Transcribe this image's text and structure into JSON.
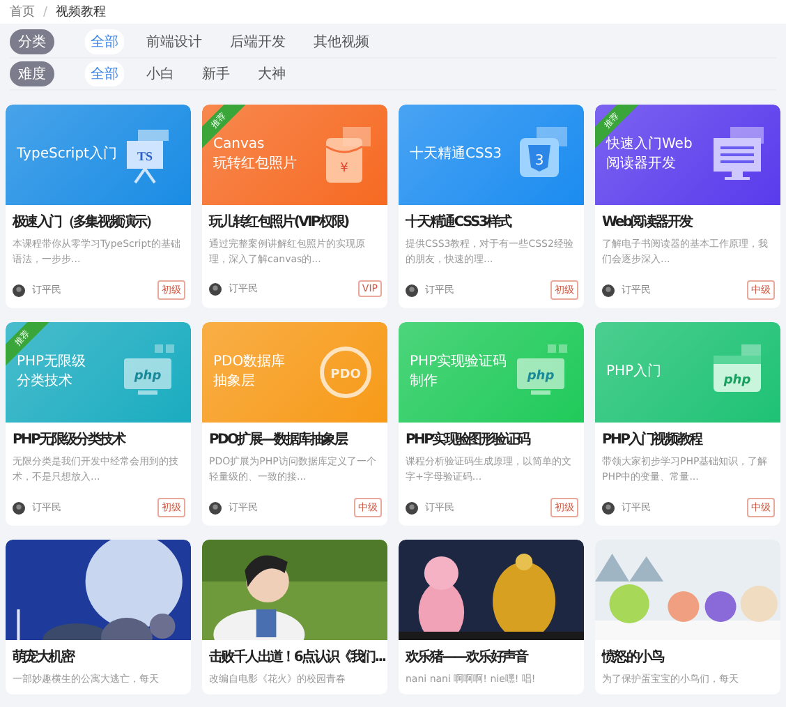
{
  "breadcrumb": [
    "首页",
    "视频教程"
  ],
  "separator": "/",
  "filters": [
    {
      "label": "分类",
      "options": [
        {
          "text": "全部",
          "selected": true
        },
        {
          "text": "前端设计",
          "selected": false
        },
        {
          "text": "后端开发",
          "selected": false
        },
        {
          "text": "其他视频",
          "selected": false
        }
      ]
    },
    {
      "label": "难度",
      "options": [
        {
          "text": "全部",
          "selected": true
        },
        {
          "text": "小白",
          "selected": false
        },
        {
          "text": "新手",
          "selected": false
        },
        {
          "text": "大神",
          "selected": false
        }
      ]
    }
  ],
  "cards": [
    {
      "media": {
        "kind": "banner",
        "color": "#1a8ce4",
        "art": {
          "kind": "board",
          "text": "TS"
        },
        "lines": [
          "TypeScript入门"
        ]
      },
      "recommended": false,
      "title": "极速入门（多集视频演示）",
      "description": "本课程带你从零学习TypeScript的基础语法，一步步...",
      "author": "订平民",
      "level": "初级"
    },
    {
      "media": {
        "kind": "banner",
        "color": "#f66a22",
        "art": {
          "kind": "envelope",
          "text": "¥"
        },
        "lines": [
          "Canvas",
          "玩转红包照片"
        ]
      },
      "recommended": true,
      "ribbon": "推荐",
      "title": "玩儿转红包照片(VIP权限)",
      "description": "通过完整案例讲解红包照片的实现原理，深入了解canvas的...",
      "author": "订平民",
      "level": "VIP"
    },
    {
      "media": {
        "kind": "banner",
        "color": "#1b8cf0",
        "art": {
          "kind": "shield",
          "text": "3"
        },
        "lines": [
          "十天精通CSS3"
        ]
      },
      "recommended": false,
      "title": "十天精通CSS3样式",
      "description": "提供CSS3教程，对于有一些CSS2经验的朋友，快速的理...",
      "author": "订平民",
      "level": "初级"
    },
    {
      "media": {
        "kind": "banner",
        "color": "#5a3bec",
        "art": {
          "kind": "monitor"
        },
        "lines": [
          "快速入门Web",
          "阅读器开发"
        ]
      },
      "recommended": true,
      "ribbon": "推荐",
      "title": "Web阅读器开发",
      "description": "了解电子书阅读器的基本工作原理，我们会逐步深入...",
      "author": "订平民",
      "level": "中级"
    },
    {
      "media": {
        "kind": "banner",
        "color": "#1aacc0",
        "art": {
          "kind": "php",
          "text": "php"
        },
        "lines": [
          "PHP无限级",
          "分类技术"
        ]
      },
      "recommended": true,
      "ribbon": "推荐",
      "title": "PHP无限级分类技术",
      "description": "无限分类是我们开发中经常会用到的技术，不是只想放入...",
      "author": "订平民",
      "level": "初级"
    },
    {
      "media": {
        "kind": "banner",
        "color": "#f79a18",
        "art": {
          "kind": "pdo",
          "text": "PDO"
        },
        "lines": [
          "PDO数据库",
          "抽象层"
        ]
      },
      "recommended": false,
      "title": "PDO扩展—数据库抽象层",
      "description": "PDO扩展为PHP访问数据库定义了一个轻量级的、一致的接...",
      "author": "订平民",
      "level": "中级"
    },
    {
      "media": {
        "kind": "banner",
        "color": "#20ca5a",
        "art": {
          "kind": "php",
          "text": "php"
        },
        "lines": [
          "PHP实现验证码",
          "制作"
        ]
      },
      "recommended": false,
      "title": "PHP实现验图形验证码",
      "description": "课程分析验证码生成原理，以简单的文字+字母验证码...",
      "author": "订平民",
      "level": "初级"
    },
    {
      "media": {
        "kind": "banner",
        "color": "#1ec274",
        "art": {
          "kind": "window",
          "text": "php"
        },
        "lines": [
          "PHP入门"
        ]
      },
      "recommended": false,
      "title": "PHP入门视频教程",
      "description": "带领大家初步学习PHP基础知识，了解PHP中的变量、常量...",
      "author": "订平民",
      "level": "中级"
    },
    {
      "recommended": false,
      "title": "萌宠大机密",
      "description": "一部妙趣横生的公寓大逃亡，每天"
    },
    {
      "recommended": false,
      "title": "击败千人出道！6点认识《我们...",
      "description": "改编自电影《花火》的校园青春"
    },
    {
      "recommended": false,
      "title": "欢乐猪——欢乐好声音",
      "description": "nani nani 啊啊啊! nie嘿! 唱!"
    },
    {
      "recommended": false,
      "title": "愤怒的小鸟",
      "description": "为了保护蛋宝宝的小鸟们，每天"
    }
  ]
}
